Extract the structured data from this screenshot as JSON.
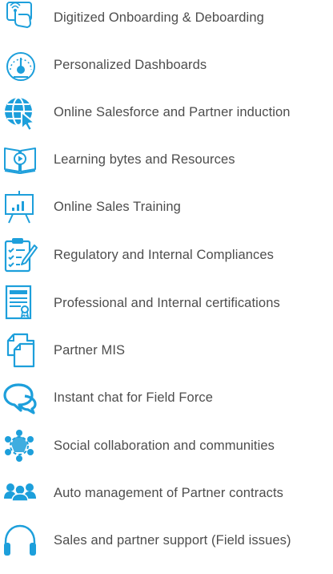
{
  "accent_color": "#1d9fdb",
  "text_color": "#4d4d4d",
  "features": [
    {
      "icon": "touch-screen-icon",
      "label": "Digitized Onboarding & Deboarding"
    },
    {
      "icon": "dashboard-gauge-icon",
      "label": "Personalized Dashboards"
    },
    {
      "icon": "globe-cursor-icon",
      "label": "Online Salesforce and Partner induction"
    },
    {
      "icon": "book-play-icon",
      "label": "Learning bytes and Resources"
    },
    {
      "icon": "presentation-board-icon",
      "label": "Online Sales Training"
    },
    {
      "icon": "clipboard-checklist-icon",
      "label": "Regulatory and Internal Compliances"
    },
    {
      "icon": "certificate-icon",
      "label": "Professional and Internal certifications"
    },
    {
      "icon": "documents-icon",
      "label": "Partner MIS"
    },
    {
      "icon": "chat-bubbles-icon",
      "label": "Instant chat for Field Force"
    },
    {
      "icon": "community-network-icon",
      "label": "Social collaboration and communities"
    },
    {
      "icon": "people-group-icon",
      "label": "Auto management of Partner contracts"
    },
    {
      "icon": "headset-icon",
      "label": "Sales and partner support (Field issues)"
    }
  ]
}
